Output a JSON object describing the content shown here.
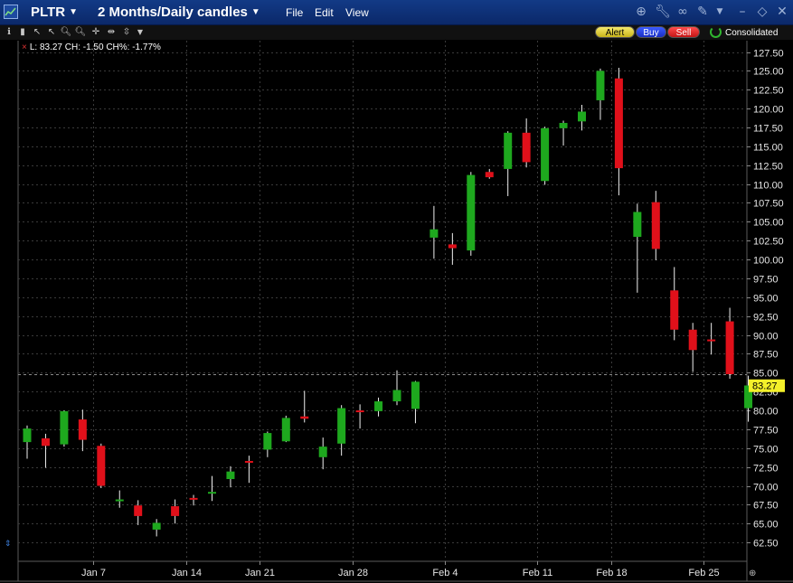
{
  "window": {
    "symbol": "PLTR",
    "period": "2 Months/Daily candles",
    "menu": [
      "File",
      "Edit",
      "View"
    ]
  },
  "toolbar": {
    "alert_label": "Alert",
    "buy_label": "Buy",
    "sell_label": "Sell",
    "consolidated_label": "Consolidated"
  },
  "readout": "L: 83.27 CH: -1.50 CH%: -1.77%",
  "colors": {
    "background": "#000000",
    "up": "#1ea81e",
    "down": "#e0101a",
    "last_price_tag": "#f3f02a",
    "grid": "#3a3a3a"
  },
  "icons": {
    "title_bar": [
      "link-icon",
      "wrench-icon",
      "chain-icon",
      "pin-icon",
      "minimize-icon",
      "restore-icon",
      "close-icon"
    ],
    "toolbar": [
      "info-icon",
      "bar-chart-icon",
      "pointer-icon",
      "zoom-in-icon",
      "zoom-out-icon",
      "crosshair-icon",
      "pan-icon",
      "expand-icon",
      "dropdown-icon"
    ]
  },
  "chart_data": {
    "type": "candlestick",
    "y_axis": {
      "min": 60,
      "max": 129,
      "ticks": [
        62.5,
        65,
        67.5,
        70,
        72.5,
        75,
        77.5,
        80,
        82.5,
        85,
        87.5,
        90,
        92.5,
        95,
        97.5,
        100,
        102.5,
        105,
        107.5,
        110,
        112.5,
        115,
        117.5,
        120,
        122.5,
        125,
        127.5
      ],
      "tick_labels": [
        "62.50",
        "65.00",
        "67.50",
        "70.00",
        "72.50",
        "75.00",
        "77.50",
        "80.00",
        "82.50",
        "85.00",
        "87.50",
        "90.00",
        "92.50",
        "95.00",
        "97.50",
        "100.00",
        "102.50",
        "105.00",
        "107.50",
        "110.00",
        "112.50",
        "115.00",
        "117.50",
        "120.00",
        "122.50",
        "125.00",
        "127.50"
      ],
      "position": "right"
    },
    "x_axis": {
      "labels": [
        {
          "label": "Jan 7",
          "index": 3
        },
        {
          "label": "Jan 14",
          "index": 8
        },
        {
          "label": "Jan 21",
          "index": 12
        },
        {
          "label": "Jan 28",
          "index": 17
        },
        {
          "label": "Feb 4",
          "index": 22
        },
        {
          "label": "Feb 11",
          "index": 27
        },
        {
          "label": "Feb 18",
          "index": 31
        },
        {
          "label": "Feb 25",
          "index": 36
        }
      ]
    },
    "grid": true,
    "last_price": 83.27,
    "last_price_label": "83.27",
    "reference_line": 84.8,
    "candles": [
      {
        "o": 75.8,
        "h": 78.0,
        "l": 73.6,
        "c": 77.6
      },
      {
        "o": 76.3,
        "h": 76.9,
        "l": 72.4,
        "c": 75.3
      },
      {
        "o": 75.5,
        "h": 80.0,
        "l": 75.2,
        "c": 79.9
      },
      {
        "o": 78.8,
        "h": 80.1,
        "l": 74.6,
        "c": 76.1
      },
      {
        "o": 75.3,
        "h": 75.6,
        "l": 69.7,
        "c": 70.0
      },
      {
        "o": 68.0,
        "h": 69.4,
        "l": 67.1,
        "c": 68.2
      },
      {
        "o": 67.4,
        "h": 68.1,
        "l": 64.8,
        "c": 66.0
      },
      {
        "o": 64.2,
        "h": 65.6,
        "l": 63.3,
        "c": 65.1
      },
      {
        "o": 67.3,
        "h": 68.2,
        "l": 65.0,
        "c": 66.0
      },
      {
        "o": 68.4,
        "h": 68.8,
        "l": 67.4,
        "c": 68.2
      },
      {
        "o": 69.0,
        "h": 71.3,
        "l": 68.0,
        "c": 69.2
      },
      {
        "o": 70.9,
        "h": 72.6,
        "l": 69.8,
        "c": 71.9
      },
      {
        "o": 73.3,
        "h": 74.0,
        "l": 70.4,
        "c": 73.1
      },
      {
        "o": 74.8,
        "h": 77.2,
        "l": 73.8,
        "c": 77.0
      },
      {
        "o": 75.9,
        "h": 79.3,
        "l": 75.8,
        "c": 79.0
      },
      {
        "o": 79.2,
        "h": 82.6,
        "l": 78.4,
        "c": 78.9
      },
      {
        "o": 73.8,
        "h": 76.4,
        "l": 72.2,
        "c": 75.2
      },
      {
        "o": 75.6,
        "h": 80.7,
        "l": 74.0,
        "c": 80.3
      },
      {
        "o": 80.0,
        "h": 80.8,
        "l": 77.6,
        "c": 79.8
      },
      {
        "o": 79.9,
        "h": 81.7,
        "l": 79.2,
        "c": 81.2
      },
      {
        "o": 81.2,
        "h": 85.3,
        "l": 80.7,
        "c": 82.7
      },
      {
        "o": 80.2,
        "h": 83.9,
        "l": 78.3,
        "c": 83.8
      },
      {
        "o": 102.9,
        "h": 107.1,
        "l": 100.1,
        "c": 104.0
      },
      {
        "o": 102.0,
        "h": 103.5,
        "l": 99.3,
        "c": 101.5
      },
      {
        "o": 101.2,
        "h": 111.6,
        "l": 100.5,
        "c": 111.2
      },
      {
        "o": 111.6,
        "h": 112.0,
        "l": 110.7,
        "c": 110.9
      },
      {
        "o": 112.0,
        "h": 117.0,
        "l": 108.4,
        "c": 116.8
      },
      {
        "o": 116.8,
        "h": 118.7,
        "l": 112.2,
        "c": 112.9
      },
      {
        "o": 110.4,
        "h": 117.6,
        "l": 109.9,
        "c": 117.4
      },
      {
        "o": 117.4,
        "h": 118.4,
        "l": 115.1,
        "c": 118.1
      },
      {
        "o": 118.3,
        "h": 120.5,
        "l": 117.1,
        "c": 119.6
      },
      {
        "o": 121.1,
        "h": 125.3,
        "l": 118.5,
        "c": 125.0
      },
      {
        "o": 124.0,
        "h": 125.4,
        "l": 108.5,
        "c": 112.1
      },
      {
        "o": 103.0,
        "h": 107.4,
        "l": 95.6,
        "c": 106.3
      },
      {
        "o": 107.6,
        "h": 109.1,
        "l": 99.9,
        "c": 101.4
      },
      {
        "o": 95.9,
        "h": 99.0,
        "l": 89.3,
        "c": 90.7
      },
      {
        "o": 90.7,
        "h": 91.6,
        "l": 85.1,
        "c": 88.0
      },
      {
        "o": 89.4,
        "h": 91.6,
        "l": 87.4,
        "c": 89.2
      },
      {
        "o": 91.8,
        "h": 93.6,
        "l": 84.2,
        "c": 84.8
      },
      {
        "o": 80.3,
        "h": 84.6,
        "l": 78.5,
        "c": 83.3
      }
    ]
  }
}
